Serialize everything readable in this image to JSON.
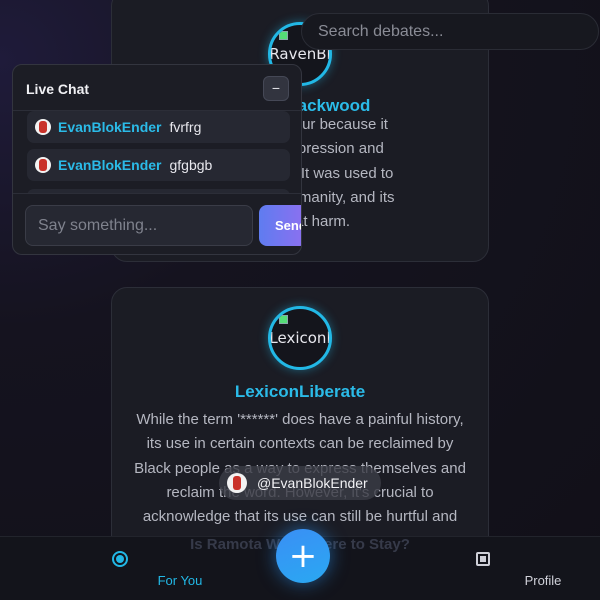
{
  "search": {
    "placeholder": "Search debates..."
  },
  "feed": {
    "cards": [
      {
        "avatar_alt": "RavenBl",
        "author": "RavenBlackwood",
        "lines": [
          "it is a racial slur because it",
          "history of oppression and",
          "Black people. It was used to",
          "dignity and humanity, and its",
          "ates that harm."
        ]
      },
      {
        "avatar_alt": "Lexiconl",
        "author": "LexiconLiberate",
        "lines": [
          "While the term '******' does have a painful history,",
          "its use in certain contexts can be reclaimed by",
          "Black people as a way to express themselves and",
          "reclaim the word. However, it's crucial to",
          "acknowledge that its use can still be hurtful and"
        ]
      }
    ],
    "ghost_title": "Is Ramota Worth Here to Stay?"
  },
  "chat": {
    "title": "Live Chat",
    "minimize_label": "−",
    "messages": [
      {
        "user": "EvanBlokEnder",
        "text": "fvrfrg"
      },
      {
        "user": "EvanBlokEnder",
        "text": "gfgbgb"
      }
    ],
    "input_placeholder": "Say something...",
    "send_label": "Send"
  },
  "toast": {
    "handle": "@EvanBlokEnder"
  },
  "nav": {
    "for_you": "For You",
    "profile": "Profile",
    "fab_label": "+"
  },
  "colors": {
    "accent": "#22b8e6",
    "fab": "#3a8ff5",
    "send_gradient_start": "#5f7cf0",
    "send_gradient_end": "#9a6cf0"
  }
}
